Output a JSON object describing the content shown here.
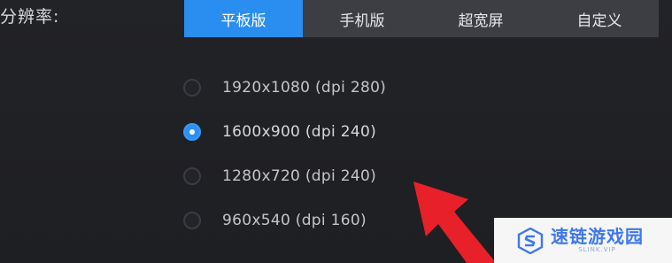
{
  "settings": {
    "label": "分辨率:",
    "tabs": [
      {
        "label": "平板版",
        "active": true
      },
      {
        "label": "手机版",
        "active": false
      },
      {
        "label": "超宽屏",
        "active": false
      },
      {
        "label": "自定义",
        "active": false
      }
    ],
    "resolutions": [
      {
        "label": "1920x1080 (dpi 280)",
        "selected": false
      },
      {
        "label": "1600x900 (dpi 240)",
        "selected": true
      },
      {
        "label": "1280x720 (dpi 240)",
        "selected": false
      },
      {
        "label": "960x540 (dpi 160)",
        "selected": false
      }
    ]
  },
  "colors": {
    "accent": "#2a8df0",
    "background": "#202125",
    "tab_background": "#3d3e43",
    "arrow": "#e8202a"
  },
  "watermark": {
    "text": "速链游戏园",
    "subtext": "SLINK.VIP",
    "icon": "slink-logo-icon"
  },
  "annotation": {
    "icon": "red-arrow-icon"
  }
}
